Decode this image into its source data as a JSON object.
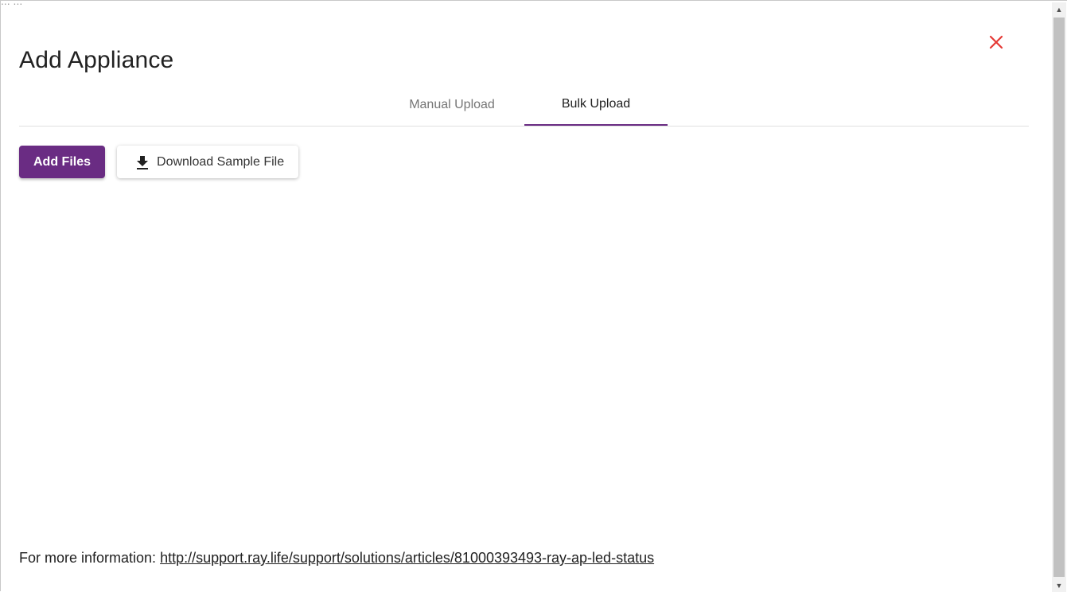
{
  "background_text": "... ...",
  "dialog": {
    "title": "Add Appliance",
    "close_icon": "close-icon",
    "close_color": "#e53935"
  },
  "tabs": [
    {
      "label": "Manual Upload",
      "active": false
    },
    {
      "label": "Bulk Upload",
      "active": true
    }
  ],
  "actions": {
    "add_files_label": "Add Files",
    "download_sample_label": "Download Sample File",
    "download_icon": "download-icon"
  },
  "footer": {
    "prefix": "For more information:",
    "link": "http://support.ray.life/support/solutions/articles/81000393493-ray-ap-led-status"
  },
  "colors": {
    "accent": "#6a2c83",
    "close": "#e53935"
  }
}
